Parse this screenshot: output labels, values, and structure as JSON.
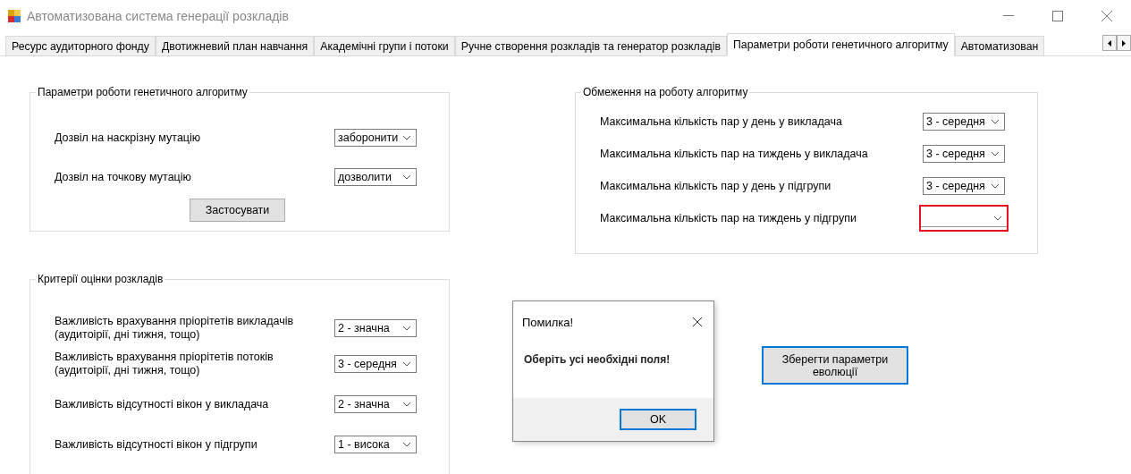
{
  "window": {
    "title": "Автоматизована система генерації розкладів"
  },
  "tabs": [
    {
      "label": "Ресурс аудиторного фонду",
      "selected": false
    },
    {
      "label": "Двотижневий план навчання",
      "selected": false
    },
    {
      "label": "Академічні групи і потоки",
      "selected": false
    },
    {
      "label": "Ручне створення розкладів та генератор розкладів",
      "selected": false
    },
    {
      "label": "Параметри роботи генетичного алгоритму",
      "selected": true
    },
    {
      "label": "Автоматизован",
      "selected": false
    }
  ],
  "algorithm_group": {
    "title": "Параметри роботи генетичного алгоритму",
    "fields": [
      {
        "label": "Дозвіл на наскрізну мутацію",
        "value": "заборонити",
        "invalid": false
      },
      {
        "label": "Дозвіл на точкову мутацію",
        "value": "дозволити",
        "invalid": false
      }
    ],
    "apply_button": "Застосувати"
  },
  "limits_group": {
    "title": "Обмеження на роботу алгоритму",
    "fields": [
      {
        "label": "Максимальна кількість пар у день у викладача",
        "value": "3 - середня",
        "invalid": false
      },
      {
        "label": "Максимальна кількість пар на тиждень у викладача",
        "value": "3 - середня",
        "invalid": false
      },
      {
        "label": "Максимальна кількість пар у день у підгрупи",
        "value": "3 - середня",
        "invalid": false
      },
      {
        "label": "Максимальна кількість пар на тиждень у підгрупи",
        "invalid": true
      }
    ]
  },
  "criteria_group": {
    "title": "Критерії оцінки розкладів",
    "fields": [
      {
        "label": "Важливість врахування пріорітетів викладачів\n(аудитоірії, дні тижня, тощо)",
        "value": "2 - значна",
        "invalid": false
      },
      {
        "label": "Важливість врахування пріорітетів потоків\n(аудитоірії, дні тижня, тощо)",
        "value": "3 - середня",
        "invalid": false
      },
      {
        "label": "Важливість відсутності вікон у викладача",
        "value": "2 - значна",
        "invalid": false
      },
      {
        "label": "Важливість відсутності вікон у підгрупи",
        "value": "1 - висока",
        "invalid": false
      }
    ]
  },
  "save_button": "Зберегти параметри\nеволюції",
  "dialog": {
    "title": "Помилка!",
    "message": "Оберіть усі необхідні поля!",
    "ok_button": "OK"
  }
}
